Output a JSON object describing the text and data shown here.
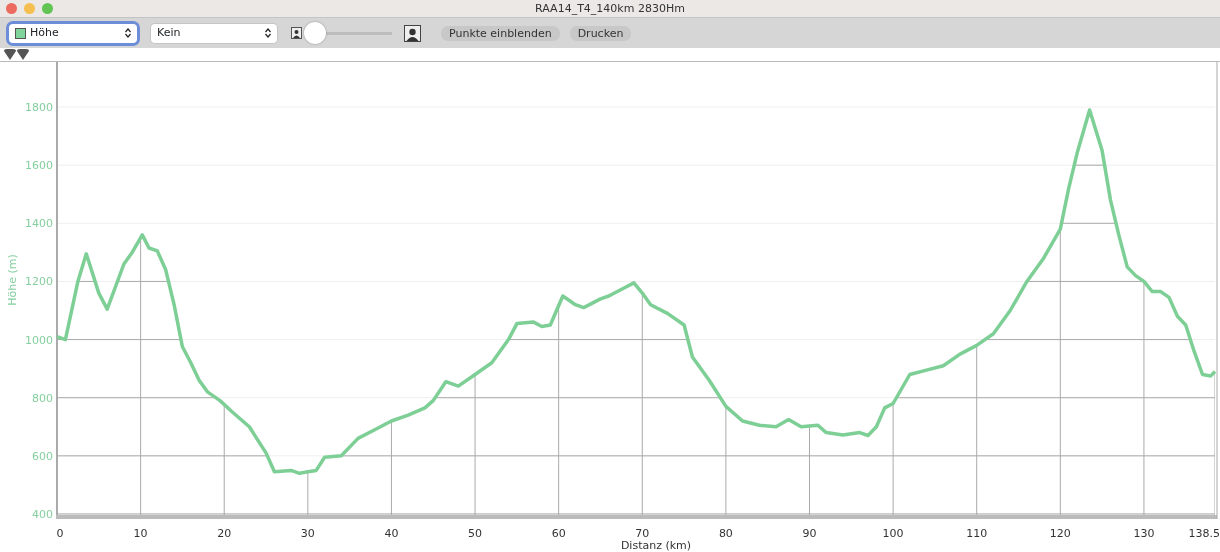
{
  "window": {
    "title": "RAA14_T4_140km 2830Hm"
  },
  "toolbar": {
    "metric_select": {
      "value": "Höhe",
      "color": "#7fd39b",
      "focused": true
    },
    "compare_select": {
      "value": "Kein",
      "focused": false
    },
    "zoom_slider": {
      "level": 0
    },
    "buttons": [
      "Punkte einblenden",
      "Drucken"
    ]
  },
  "chart": {
    "chart_data": {
      "type": "line",
      "xlabel": "Distanz (km)",
      "ylabel": "Höhe (m)",
      "x": [
        0,
        1,
        2.5,
        3.5,
        5,
        6,
        8,
        9,
        10.2,
        11,
        12,
        13,
        14,
        15,
        16,
        17,
        18,
        19.5,
        21,
        23,
        25,
        26,
        28,
        29,
        30,
        31,
        32,
        34,
        36,
        38,
        40,
        42,
        44,
        45,
        46.5,
        48,
        50,
        52,
        54,
        55,
        57,
        58,
        59,
        60.5,
        62,
        63,
        65,
        66,
        68,
        69,
        70,
        71,
        73,
        75,
        76,
        78,
        80,
        82,
        84,
        86,
        87.5,
        89,
        91,
        92,
        94,
        96,
        97,
        98,
        99,
        100,
        102,
        104,
        106,
        108,
        110,
        112,
        114,
        116,
        118,
        120,
        121,
        122,
        123.5,
        125,
        126,
        127,
        128,
        129,
        130,
        131,
        132,
        133,
        134,
        135,
        136,
        137,
        138,
        138.5
      ],
      "grid": true,
      "series": [
        {
          "color": "#7dcf96",
          "values": [
            1010,
            1000,
            1200,
            1295,
            1160,
            1105,
            1260,
            1300,
            1360,
            1315,
            1305,
            1240,
            1120,
            975,
            920,
            860,
            820,
            790,
            750,
            700,
            610,
            545,
            550,
            540,
            545,
            550,
            595,
            600,
            660,
            690,
            720,
            740,
            765,
            790,
            855,
            840,
            880,
            920,
            1000,
            1055,
            1060,
            1045,
            1050,
            1150,
            1120,
            1110,
            1140,
            1150,
            1180,
            1195,
            1160,
            1120,
            1090,
            1050,
            940,
            860,
            770,
            720,
            705,
            700,
            725,
            700,
            705,
            680,
            672,
            680,
            670,
            700,
            765,
            780,
            880,
            895,
            910,
            950,
            980,
            1020,
            1100,
            1200,
            1280,
            1380,
            1520,
            1640,
            1790,
            1650,
            1480,
            1360,
            1250,
            1220,
            1200,
            1165,
            1165,
            1145,
            1080,
            1050,
            960,
            880,
            875,
            890
          ]
        }
      ],
      "xlim": [
        0,
        138.5
      ],
      "ylim": [
        393,
        1955
      ],
      "xticks": [
        0,
        10,
        20,
        30,
        40,
        50,
        60,
        70,
        80,
        90,
        100,
        110,
        120,
        130,
        138.5
      ],
      "yticks": [
        400,
        600,
        800,
        1000,
        1200,
        1400,
        1600,
        1800
      ]
    }
  }
}
